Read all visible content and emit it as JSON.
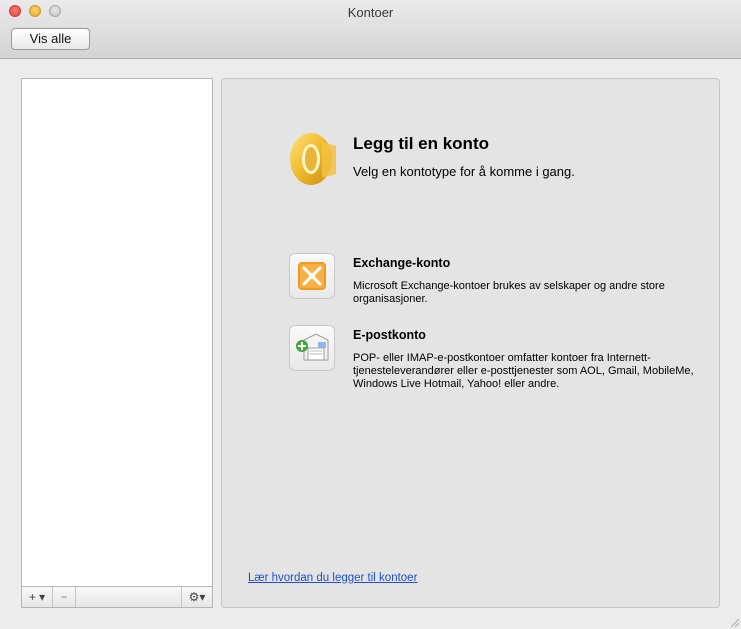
{
  "window": {
    "title": "Kontoer"
  },
  "toolbar": {
    "show_all_label": "Vis alle"
  },
  "sidebar": {
    "add_label": "+ ▾",
    "remove_label": "−",
    "action_label": "⚙▾"
  },
  "main": {
    "heading": "Legg til en konto",
    "subheading": "Velg en kontotype for å komme i gang.",
    "accounts": [
      {
        "title": "Exchange-konto",
        "description": "Microsoft Exchange-kontoer brukes av selskaper og andre store organisasjoner.",
        "icon": "exchange-icon"
      },
      {
        "title": "E-postkonto",
        "description": "POP- eller IMAP-e-postkontoer omfatter kontoer fra Internett-tjenesteleverandører eller e-posttjenester som AOL, Gmail, MobileMe, Windows Live Hotmail, Yahoo! eller andre.",
        "icon": "mail-account-icon"
      }
    ],
    "help_link": "Lær hvordan du legger til kontoer"
  },
  "colors": {
    "link": "#1f4fc8",
    "outlook_gold": "#e8b22d",
    "exchange_orange": "#f29a1f"
  }
}
